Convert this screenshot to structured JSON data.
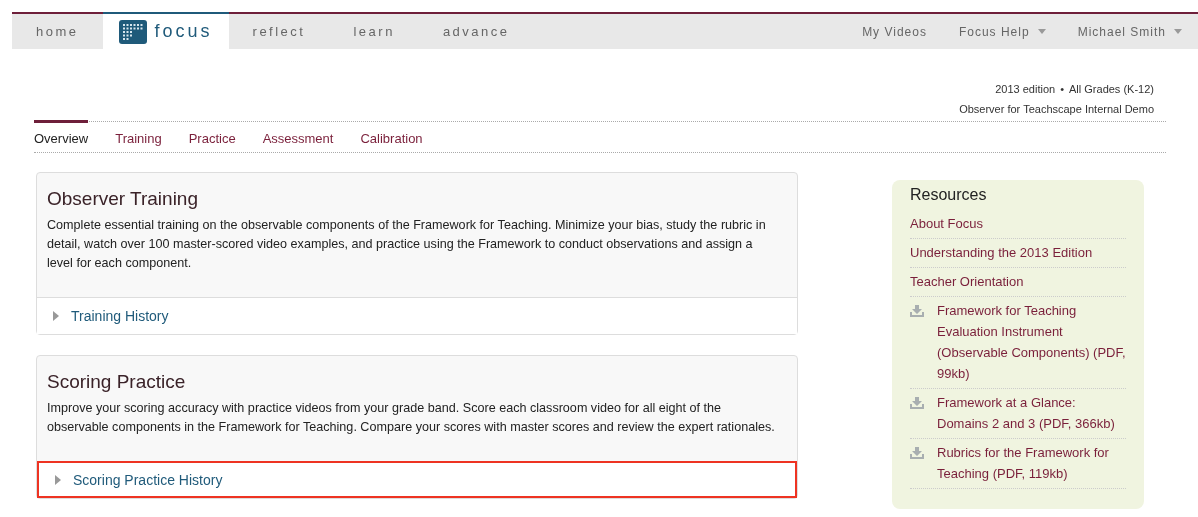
{
  "nav": {
    "left": [
      {
        "label": "home",
        "selected": false,
        "kind": "text"
      },
      {
        "label": "focus",
        "selected": true,
        "kind": "logo"
      },
      {
        "label": "reflect",
        "selected": false,
        "kind": "text"
      },
      {
        "label": "learn",
        "selected": false,
        "kind": "text"
      },
      {
        "label": "advance",
        "selected": false,
        "kind": "text"
      }
    ],
    "right": [
      {
        "label": "My Videos",
        "dropdown": false
      },
      {
        "label": "Focus Help",
        "dropdown": true
      },
      {
        "label": "Michael Smith",
        "dropdown": true
      }
    ]
  },
  "meta": {
    "edition": "2013 edition",
    "separator": "•",
    "grades": "All Grades (K-12)",
    "account": "Observer for Teachscape Internal Demo"
  },
  "tabs": [
    {
      "label": "Overview",
      "selected": true
    },
    {
      "label": "Training",
      "selected": false
    },
    {
      "label": "Practice",
      "selected": false
    },
    {
      "label": "Assessment",
      "selected": false
    },
    {
      "label": "Calibration",
      "selected": false
    }
  ],
  "sections": [
    {
      "title": "Observer Training",
      "description": "Complete essential training on the observable components of the Framework for Teaching. Minimize your bias, study the rubric in detail, watch over 100 master-scored video examples, and practice using the Framework to conduct observations and assign a level for each component.",
      "history": {
        "label": "Training History",
        "highlighted": false
      }
    },
    {
      "title": "Scoring Practice",
      "description": "Improve your scoring accuracy with practice videos from your grade band. Score each classroom video for all eight of the observable components in the Framework for Teaching. Compare your scores with master scores and review the expert rationales.",
      "history": {
        "label": "Scoring Practice History",
        "highlighted": true
      }
    }
  ],
  "resources": {
    "title": "Resources",
    "items": [
      {
        "label": "About Focus",
        "kind": "link"
      },
      {
        "label": "Understanding the 2013 Edition",
        "kind": "link"
      },
      {
        "label": "Teacher Orientation",
        "kind": "link"
      },
      {
        "label": "Framework for Teaching Evaluation Instrument (Observable Components) (PDF, 99kb)",
        "kind": "download"
      },
      {
        "label": "Framework at a Glance: Domains 2 and 3 (PDF, 366kb)",
        "kind": "download"
      },
      {
        "label": "Rubrics for the Framework for Teaching (PDF, 119kb)",
        "kind": "download"
      }
    ]
  }
}
